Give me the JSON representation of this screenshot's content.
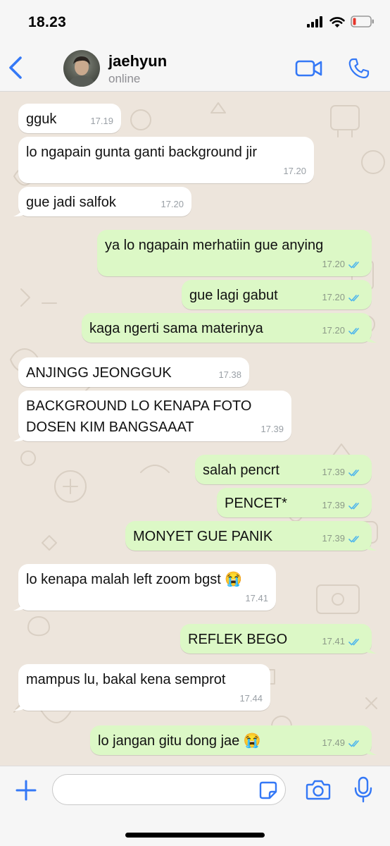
{
  "status_bar": {
    "time": "18.23"
  },
  "header": {
    "contact_name": "jaehyun",
    "contact_status": "online"
  },
  "colors": {
    "accent": "#3478f6",
    "incoming_bubble": "#ffffff",
    "outgoing_bubble": "#dcf8c6",
    "read_ticks": "#4fb6ec",
    "wallpaper": "#ede5dc"
  },
  "messages": [
    {
      "dir": "in",
      "text": "gguk",
      "time": "17.19"
    },
    {
      "dir": "in",
      "text": "lo ngapain gunta ganti background jir",
      "time": "17.20"
    },
    {
      "dir": "in",
      "text": "gue jadi salfok",
      "time": "17.20"
    },
    {
      "dir": "out",
      "text": "ya lo ngapain merhatiin gue anying",
      "time": "17.20",
      "status": "read"
    },
    {
      "dir": "out",
      "text": "gue lagi gabut",
      "time": "17.20",
      "status": "read"
    },
    {
      "dir": "out",
      "text": "kaga ngerti sama materinya",
      "time": "17.20",
      "status": "read"
    },
    {
      "dir": "in",
      "text": "ANJINGG JEONGGUK",
      "time": "17.38"
    },
    {
      "dir": "in",
      "text": "BACKGROUND LO KENAPA FOTO",
      "text2": "DOSEN KIM BANGSAAAT",
      "time": "17.39"
    },
    {
      "dir": "out",
      "text": "salah pencrt",
      "time": "17.39",
      "status": "read"
    },
    {
      "dir": "out",
      "text": "PENCET*",
      "time": "17.39",
      "status": "read"
    },
    {
      "dir": "out",
      "text": "MONYET GUE PANIK",
      "time": "17.39",
      "status": "read"
    },
    {
      "dir": "in",
      "text": "lo kenapa malah left zoom bgst 😭",
      "time": "17.41"
    },
    {
      "dir": "out",
      "text": "REFLEK BEGO",
      "time": "17.41",
      "status": "read"
    },
    {
      "dir": "in",
      "text": "mampus lu, bakal kena semprot",
      "time": "17.44"
    },
    {
      "dir": "out",
      "text": "lo jangan gitu dong jae 😭",
      "time": "17.49",
      "status": "read"
    }
  ],
  "composer": {
    "value": "",
    "placeholder": ""
  }
}
